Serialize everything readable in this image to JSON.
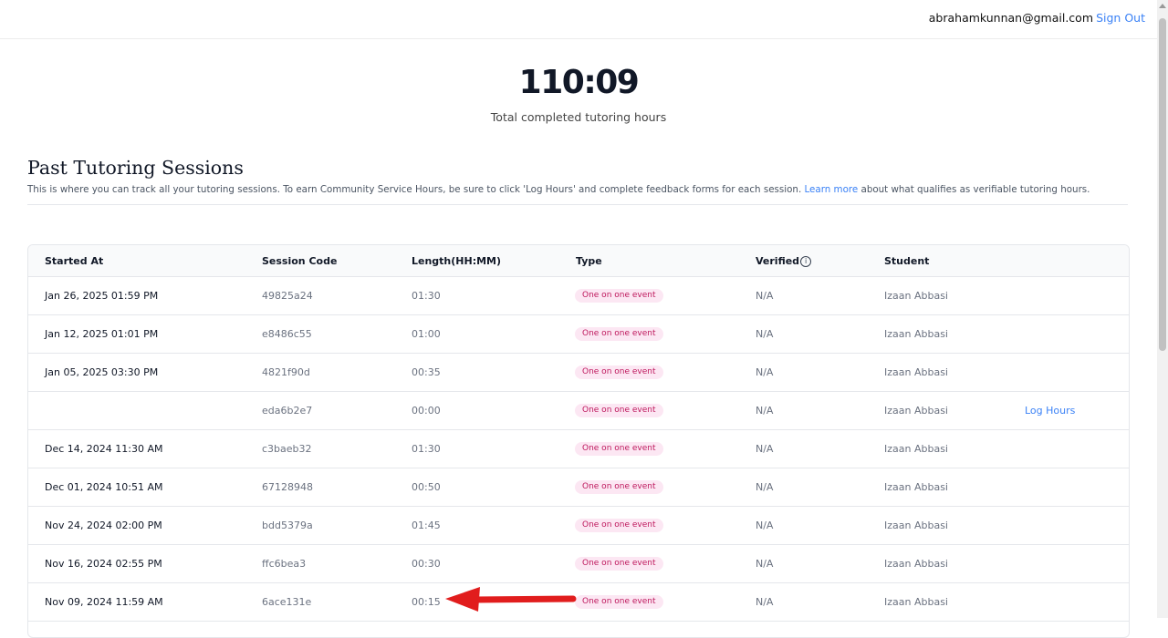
{
  "header": {
    "email": "abrahamkunnan@gmail.com",
    "sign_out_label": "Sign Out"
  },
  "summary": {
    "total_hours": "110:09",
    "caption": "Total completed tutoring hours"
  },
  "section": {
    "title": "Past Tutoring Sessions",
    "description_before": "This is where you can track all your tutoring sessions. To earn Community Service Hours, be sure to click 'Log Hours' and complete feedback forms for each session. ",
    "learn_more_label": "Learn more",
    "description_after": " about what qualifies as verifiable tutoring hours."
  },
  "table": {
    "columns": [
      "Started At",
      "Session Code",
      "Length(HH:MM)",
      "Type",
      "Verified",
      "Student"
    ],
    "rows": [
      {
        "started": "Jan 26, 2025 01:59 PM",
        "code": "49825a24",
        "length": "01:30",
        "type": "One on one event",
        "verified": "N/A",
        "student": "Izaan Abbasi",
        "action": ""
      },
      {
        "started": "Jan 12, 2025 01:01 PM",
        "code": "e8486c55",
        "length": "01:00",
        "type": "One on one event",
        "verified": "N/A",
        "student": "Izaan Abbasi",
        "action": ""
      },
      {
        "started": "Jan 05, 2025 03:30 PM",
        "code": "4821f90d",
        "length": "00:35",
        "type": "One on one event",
        "verified": "N/A",
        "student": "Izaan Abbasi",
        "action": ""
      },
      {
        "started": "",
        "code": "eda6b2e7",
        "length": "00:00",
        "type": "One on one event",
        "verified": "N/A",
        "student": "Izaan Abbasi",
        "action": "Log Hours"
      },
      {
        "started": "Dec 14, 2024 11:30 AM",
        "code": "c3baeb32",
        "length": "01:30",
        "type": "One on one event",
        "verified": "N/A",
        "student": "Izaan Abbasi",
        "action": ""
      },
      {
        "started": "Dec 01, 2024 10:51 AM",
        "code": "67128948",
        "length": "00:50",
        "type": "One on one event",
        "verified": "N/A",
        "student": "Izaan Abbasi",
        "action": ""
      },
      {
        "started": "Nov 24, 2024 02:00 PM",
        "code": "bdd5379a",
        "length": "01:45",
        "type": "One on one event",
        "verified": "N/A",
        "student": "Izaan Abbasi",
        "action": ""
      },
      {
        "started": "Nov 16, 2024 02:55 PM",
        "code": "ffc6bea3",
        "length": "00:30",
        "type": "One on one event",
        "verified": "N/A",
        "student": "Izaan Abbasi",
        "action": ""
      },
      {
        "started": "Nov 09, 2024 11:59 AM",
        "code": "6ace131e",
        "length": "00:15",
        "type": "One on one event",
        "verified": "N/A",
        "student": "Izaan Abbasi",
        "action": ""
      }
    ]
  },
  "colors": {
    "accent": "#3b82f6",
    "badge_text": "#be185d",
    "badge_bg": "#fce7f3",
    "annotation": "#e11d1d"
  }
}
